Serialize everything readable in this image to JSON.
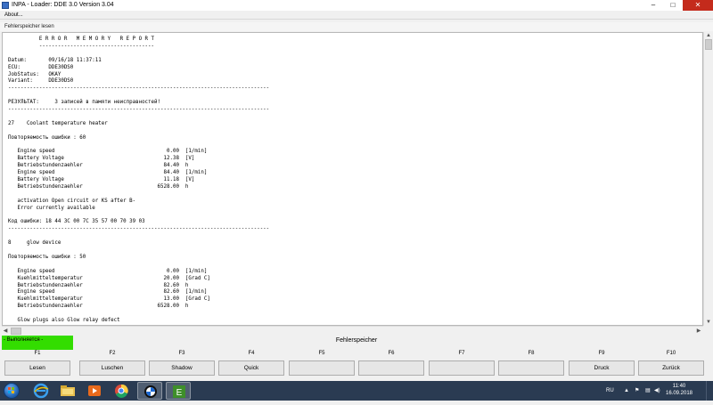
{
  "window": {
    "title": "INPA - Loader:  DDE 3.0 Version 3.04",
    "min_glyph": "–",
    "max_glyph": "□",
    "close_glyph": "✕"
  },
  "menu": {
    "about": "About..."
  },
  "subwindow": {
    "title": "Fehlerspeicher lesen"
  },
  "report": {
    "lines": [
      "          E R R O R   M E M O R Y   R E P O R T",
      "          -------------------------------------",
      "",
      "Datum:       09/16/18 11:37:11",
      "ECU:         DDE30DS0",
      "JobStatus:   OKAY",
      "Variant:     DDE30DS0",
      "------------------------------------------------------------------------------------",
      "",
      "РЕЗУЛЬТАТ:     3 записей в памяти неисправностей!",
      "------------------------------------------------------------------------------------",
      "",
      "27    Coolant temperature heater",
      "",
      "Повторяемость ошибки : 60",
      "",
      "   Engine speed                                    0.00  [1/min]",
      "   Battery Voltage                                12.38  [V]",
      "   Betriebstundenzaehler                          84.40  h",
      "   Engine speed                                   84.40  [1/min]",
      "   Battery Voltage                                11.18  [V]",
      "   Betriebstundenzaehler                        6528.00  h",
      "",
      "   activation Open circuit or KS after B-",
      "   Error currently available",
      "",
      "Код ошибки: 18 44 3C 00 7C 35 57 00 70 39 03",
      "------------------------------------------------------------------------------------",
      "",
      "8     glow device",
      "",
      "Повторяемость ошибки : 50",
      "",
      "   Engine speed                                    0.00  [1/min]",
      "   Kuehlmitteltemperatur                          20.00  [Grad C]",
      "   Betriebstundenzaehler                          82.60  h",
      "   Engine speed                                   82.60  [1/min]",
      "   Kuehlmitteltemperatur                          13.00  [Grad C]",
      "   Betriebstundenzaehler                        6528.00  h",
      "",
      "   Glow plugs also Glow relay defect"
    ]
  },
  "status": {
    "indicator": "- Выполняется -",
    "indicator_color": "#33dd00",
    "section_title": "Fehlerspeicher"
  },
  "function_keys": [
    {
      "key": "F1",
      "label": "Lesen"
    },
    {
      "key": "F2",
      "label": "Luschen"
    },
    {
      "key": "F3",
      "label": "Shadow"
    },
    {
      "key": "F4",
      "label": "Quick"
    },
    {
      "key": "F5",
      "label": ""
    },
    {
      "key": "F6",
      "label": ""
    },
    {
      "key": "F7",
      "label": ""
    },
    {
      "key": "F8",
      "label": ""
    },
    {
      "key": "F9",
      "label": "Druck"
    },
    {
      "key": "F10",
      "label": "Zurück"
    }
  ],
  "taskbar": {
    "apps": [
      {
        "name": "ie-icon"
      },
      {
        "name": "explorer-icon"
      },
      {
        "name": "media-player-icon"
      },
      {
        "name": "chrome-icon"
      },
      {
        "name": "bmw-icon"
      },
      {
        "name": "ediabas-icon"
      }
    ],
    "language": "RU",
    "time": "11:40",
    "date": "16.09.2018"
  }
}
